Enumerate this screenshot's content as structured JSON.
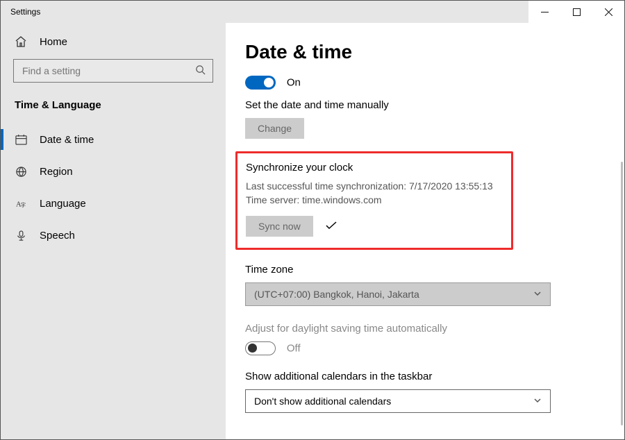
{
  "window": {
    "title": "Settings"
  },
  "sidebar": {
    "home": "Home",
    "searchPlaceholder": "Find a setting",
    "section": "Time & Language",
    "items": [
      {
        "label": "Date & time"
      },
      {
        "label": "Region"
      },
      {
        "label": "Language"
      },
      {
        "label": "Speech"
      }
    ]
  },
  "page": {
    "heading": "Date & time",
    "autoOn": "On",
    "manualLabel": "Set the date and time manually",
    "changeBtn": "Change",
    "syncHeading": "Synchronize your clock",
    "syncLast": "Last successful time synchronization: 7/17/2020 13:55:13",
    "syncServer": "Time server: time.windows.com",
    "syncBtn": "Sync now",
    "tzHeading": "Time zone",
    "tzValue": "(UTC+07:00) Bangkok, Hanoi, Jakarta",
    "dstLabel": "Adjust for daylight saving time automatically",
    "dstOff": "Off",
    "calHeading": "Show additional calendars in the taskbar",
    "calValue": "Don't show additional calendars"
  }
}
